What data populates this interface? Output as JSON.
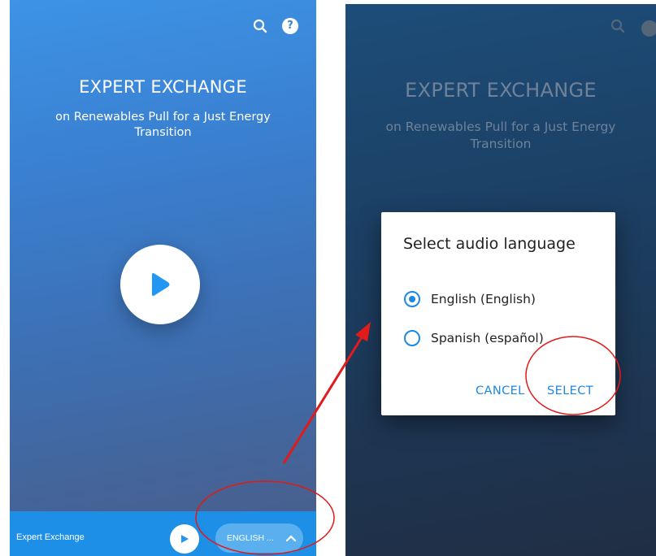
{
  "left_screen": {
    "title": "EXPERT EXCHANGE",
    "subtitle": "on Renewables Pull for a Just Energy Transition",
    "help_glyph": "?",
    "bottom_bar": {
      "program_name": "Expert Exchange",
      "language_label": "ENGLISH ..."
    },
    "icons": [
      "search-icon",
      "help-icon",
      "play-icon",
      "chevron-up-icon"
    ]
  },
  "right_screen": {
    "title": "EXPERT EXCHANGE",
    "subtitle": "on Renewables Pull for a Just Energy Transition",
    "dialog": {
      "title": "Select audio language",
      "options": [
        {
          "label": "English (English)",
          "selected": true
        },
        {
          "label": "Spanish (español)",
          "selected": false
        }
      ],
      "cancel_label": "CANCEL",
      "select_label": "SELECT"
    }
  },
  "colors": {
    "accent_blue": "#1e88e5",
    "bottom_bar": "#1e8fe6",
    "annotation_red": "#e11a1a"
  }
}
